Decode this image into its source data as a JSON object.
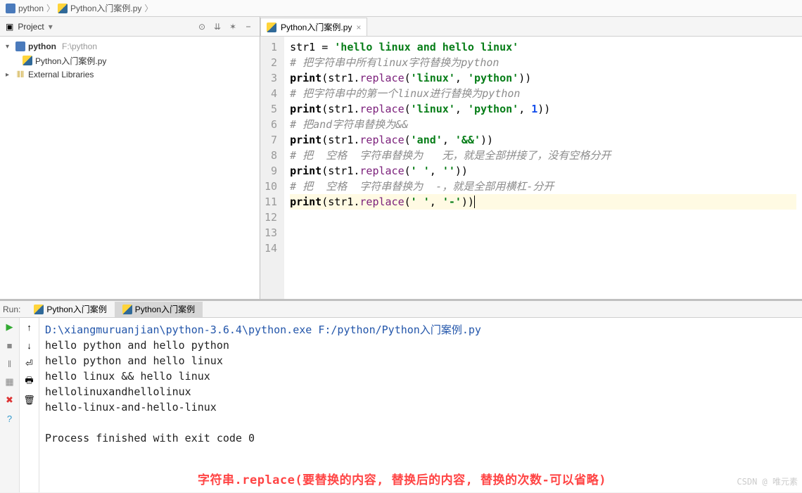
{
  "breadcrumb": {
    "seg1": "python",
    "seg2": "Python入门案例.py"
  },
  "project": {
    "header": "Project",
    "root": "python",
    "rootPath": "F:\\python",
    "file1": "Python入门案例.py",
    "ext": "External Libraries"
  },
  "editor": {
    "tab": "Python入门案例.py",
    "lines": [
      [
        {
          "t": "id",
          "s": "str1"
        },
        {
          "t": "op",
          "s": " = "
        },
        {
          "t": "str",
          "s": "'hello linux and hello linux'"
        }
      ],
      [
        {
          "t": "cmt",
          "s": "# 把字符串中所有linux字符替换为python"
        }
      ],
      [
        {
          "t": "kw",
          "s": "print"
        },
        {
          "t": "op",
          "s": "("
        },
        {
          "t": "id",
          "s": "str1"
        },
        {
          "t": "op",
          "s": "."
        },
        {
          "t": "fn",
          "s": "replace"
        },
        {
          "t": "op",
          "s": "("
        },
        {
          "t": "str",
          "s": "'linux'"
        },
        {
          "t": "op",
          "s": ", "
        },
        {
          "t": "str",
          "s": "'python'"
        },
        {
          "t": "op",
          "s": "))"
        }
      ],
      [
        {
          "t": "cmt",
          "s": "# 把字符串中的第一个linux进行替换为python"
        }
      ],
      [
        {
          "t": "kw",
          "s": "print"
        },
        {
          "t": "op",
          "s": "("
        },
        {
          "t": "id",
          "s": "str1"
        },
        {
          "t": "op",
          "s": "."
        },
        {
          "t": "fn",
          "s": "replace"
        },
        {
          "t": "op",
          "s": "("
        },
        {
          "t": "str",
          "s": "'linux'"
        },
        {
          "t": "op",
          "s": ", "
        },
        {
          "t": "str",
          "s": "'python'"
        },
        {
          "t": "op",
          "s": ", "
        },
        {
          "t": "num",
          "s": "1"
        },
        {
          "t": "op",
          "s": "))"
        }
      ],
      [
        {
          "t": "cmt",
          "s": "# 把and字符串替换为&&"
        }
      ],
      [
        {
          "t": "kw",
          "s": "print"
        },
        {
          "t": "op",
          "s": "("
        },
        {
          "t": "id",
          "s": "str1"
        },
        {
          "t": "op",
          "s": "."
        },
        {
          "t": "fn",
          "s": "replace"
        },
        {
          "t": "op",
          "s": "("
        },
        {
          "t": "str",
          "s": "'and'"
        },
        {
          "t": "op",
          "s": ", "
        },
        {
          "t": "str",
          "s": "'&&'"
        },
        {
          "t": "op",
          "s": "))"
        }
      ],
      [
        {
          "t": "cmt",
          "s": "# 把  空格  字符串替换为   无，就是全部拼接了，没有空格分开"
        }
      ],
      [
        {
          "t": "kw",
          "s": "print"
        },
        {
          "t": "op",
          "s": "("
        },
        {
          "t": "id",
          "s": "str1"
        },
        {
          "t": "op",
          "s": "."
        },
        {
          "t": "fn",
          "s": "replace"
        },
        {
          "t": "op",
          "s": "("
        },
        {
          "t": "str",
          "s": "' '"
        },
        {
          "t": "op",
          "s": ", "
        },
        {
          "t": "str",
          "s": "''"
        },
        {
          "t": "op",
          "s": "))"
        }
      ],
      [
        {
          "t": "cmt",
          "s": "# 把  空格  字符串替换为  -，就是全部用横杠-分开"
        }
      ],
      [
        {
          "t": "kw",
          "s": "print"
        },
        {
          "t": "op",
          "s": "("
        },
        {
          "t": "id",
          "s": "str1"
        },
        {
          "t": "op",
          "s": "."
        },
        {
          "t": "fn",
          "s": "replace"
        },
        {
          "t": "op",
          "s": "("
        },
        {
          "t": "str",
          "s": "' '"
        },
        {
          "t": "op",
          "s": ", "
        },
        {
          "t": "str",
          "s": "'-'"
        },
        {
          "t": "op",
          "s": "))"
        }
      ],
      [],
      [],
      []
    ],
    "highlight": 11,
    "lineCount": 14
  },
  "run": {
    "label": "Run:",
    "tab1": "Python入门案例",
    "tab2": "Python入门案例",
    "cmd": "D:\\xiangmuruanjian\\python-3.6.4\\python.exe F:/python/Python入门案例.py",
    "out": [
      "hello python and hello python",
      "hello python and hello linux",
      "hello linux && hello linux",
      "hellolinuxandhellolinux",
      "hello-linux-and-hello-linux",
      "",
      "Process finished with exit code 0"
    ]
  },
  "annotation": "字符串.replace(要替换的内容, 替换后的内容, 替换的次数-可以省略)",
  "watermark": "CSDN @ 唯元素"
}
